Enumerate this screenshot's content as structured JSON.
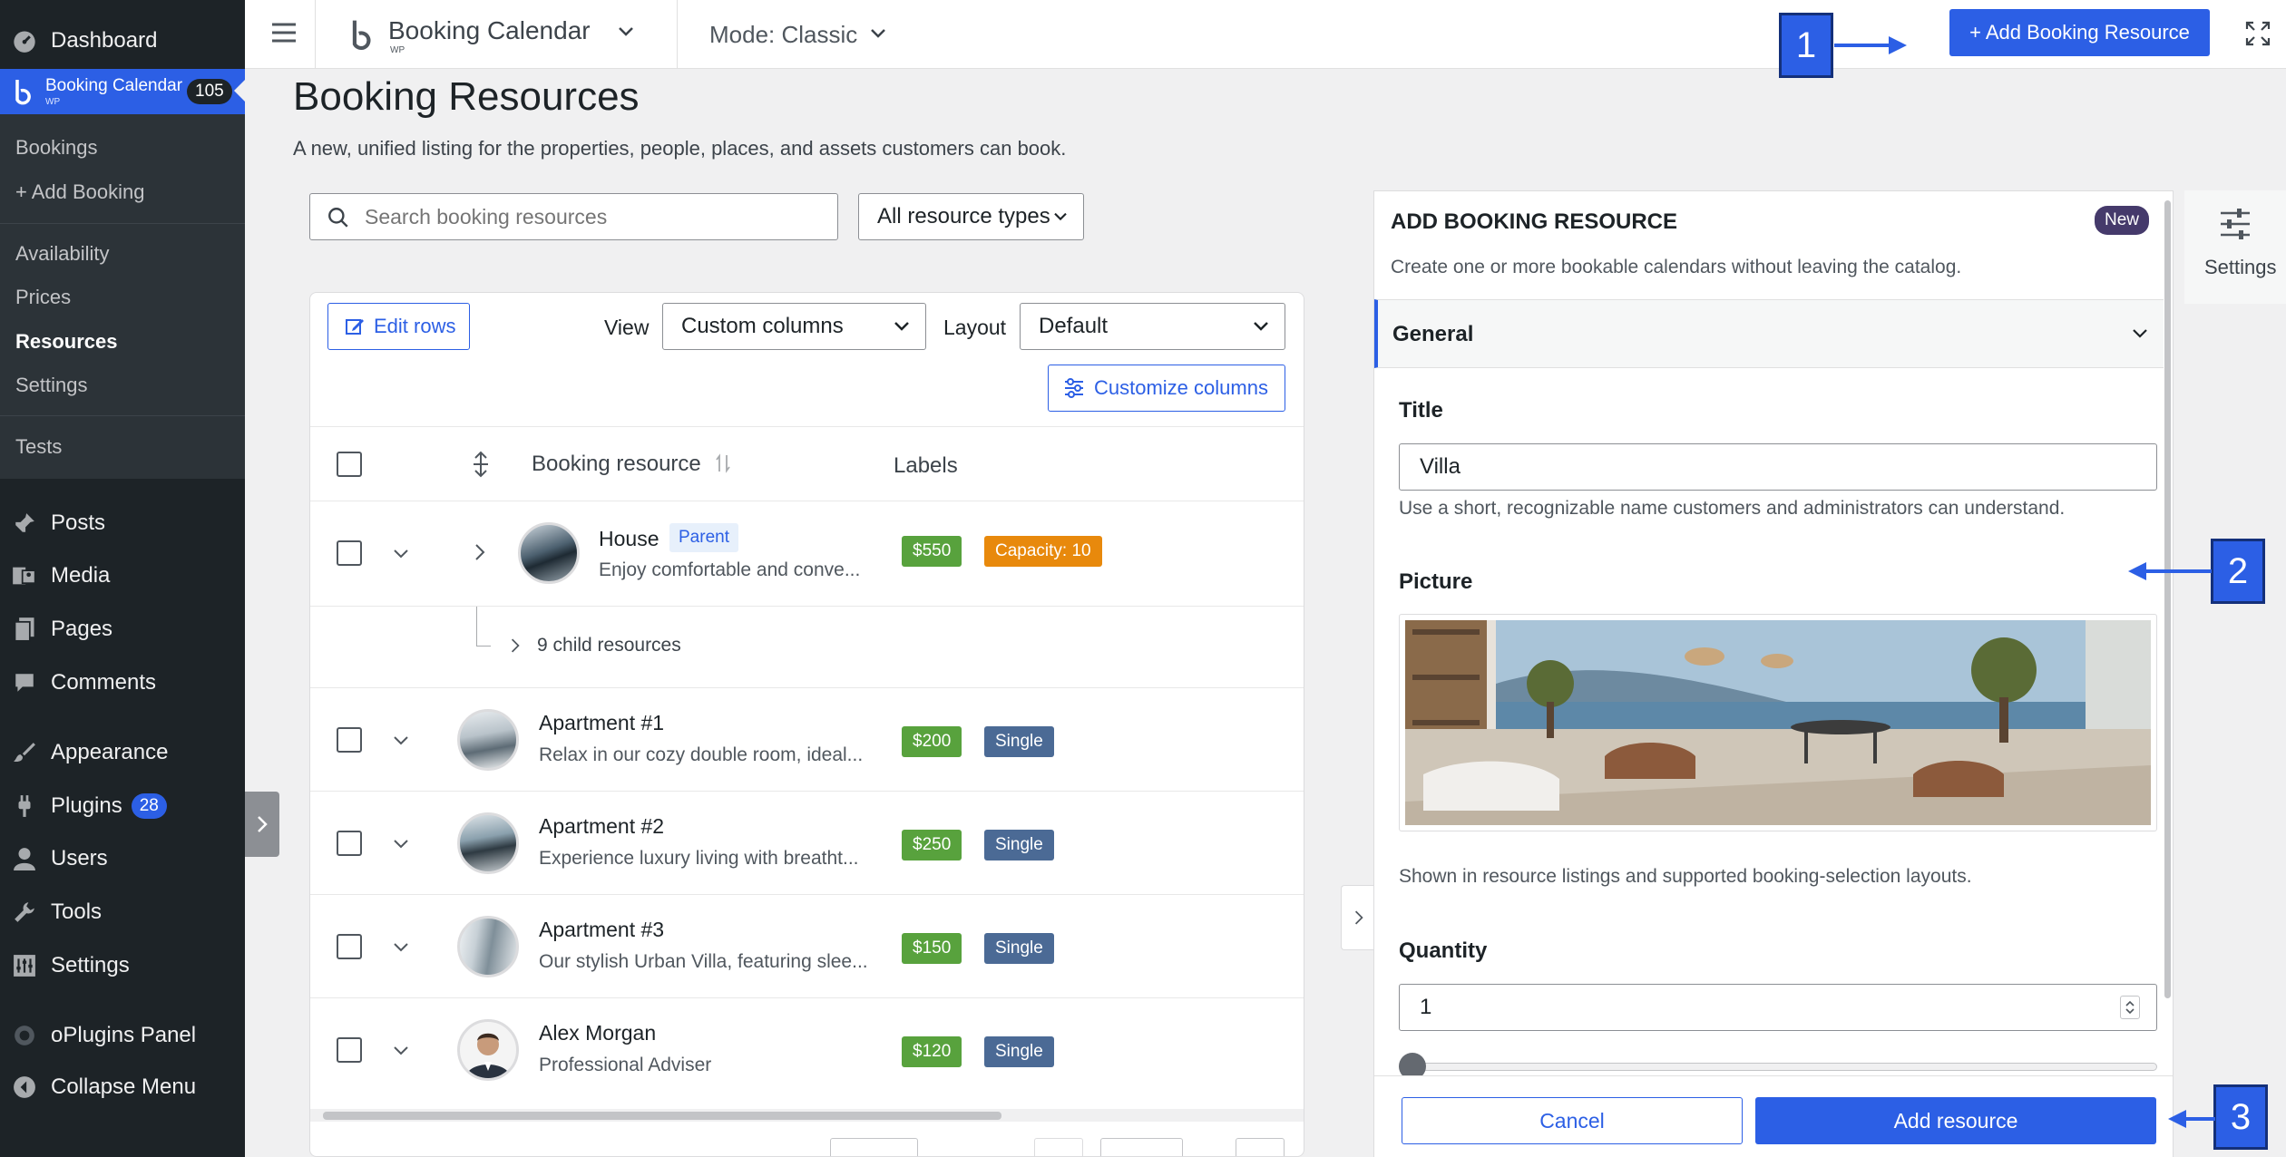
{
  "wp_menu": {
    "dashboard": "Dashboard",
    "booking_calendar": "Booking Calendar",
    "booking_calendar_small": "WP",
    "booking_count": "105",
    "submenu": [
      "Bookings",
      "+ Add Booking",
      "Availability",
      "Prices",
      "Resources",
      "Settings",
      "Tests"
    ],
    "posts": "Posts",
    "media": "Media",
    "pages": "Pages",
    "comments": "Comments",
    "appearance": "Appearance",
    "plugins": "Plugins",
    "plugins_count": "28",
    "users": "Users",
    "tools": "Tools",
    "settings": "Settings",
    "oplugins": "oPlugins Panel",
    "collapse": "Collapse Menu"
  },
  "topbar": {
    "brand": "Booking Calendar",
    "brand_sub": "WP",
    "mode": "Mode: Classic",
    "add_button": "+ Add Booking Resource"
  },
  "page": {
    "title": "Booking Resources",
    "subtitle": "A new, unified listing for the properties, people, places, and assets customers can book.",
    "search_placeholder": "Search booking resources",
    "type_filter": "All resource types"
  },
  "toolbar": {
    "edit_rows": "Edit rows",
    "view_label": "View",
    "view_value": "Custom columns",
    "layout_label": "Layout",
    "layout_value": "Default",
    "customize": "Customize columns"
  },
  "table": {
    "col_resource": "Booking resource",
    "col_labels": "Labels",
    "rows": [
      {
        "title": "House",
        "badge": "Parent",
        "desc": "Enjoy comfortable and conve...",
        "price": "$550",
        "tag": "Capacity: 10"
      },
      {
        "title": "Apartment #1",
        "desc": "Relax in our cozy double room, ideal...",
        "price": "$200",
        "tag": "Single"
      },
      {
        "title": "Apartment #2",
        "desc": "Experience luxury living with breatht...",
        "price": "$250",
        "tag": "Single"
      },
      {
        "title": "Apartment #3",
        "desc": "Our stylish Urban Villa, featuring slee...",
        "price": "$150",
        "tag": "Single"
      },
      {
        "title": "Alex Morgan",
        "desc": "Professional Adviser",
        "price": "$120",
        "tag": "Single"
      }
    ],
    "child_resources": "9 child resources"
  },
  "panel": {
    "heading": "ADD BOOKING RESOURCE",
    "new_badge": "New",
    "intro": "Create one or more bookable calendars without leaving the catalog.",
    "section": "General",
    "title_label": "Title",
    "title_value": "Villa",
    "title_help": "Use a short, recognizable name customers and administrators can understand.",
    "picture_label": "Picture",
    "picture_help": "Shown in resource listings and supported booking-selection layouts.",
    "quantity_label": "Quantity",
    "quantity_value": "1",
    "cancel": "Cancel",
    "submit": "Add resource",
    "settings_tab": "Settings"
  },
  "callouts": [
    "1",
    "2",
    "3"
  ],
  "colors": {
    "accent": "#2c5fe5",
    "price": "#58a23d",
    "tag": "#4b6a95",
    "capacity": "#e8890c",
    "sidebar": "#1d2327"
  }
}
